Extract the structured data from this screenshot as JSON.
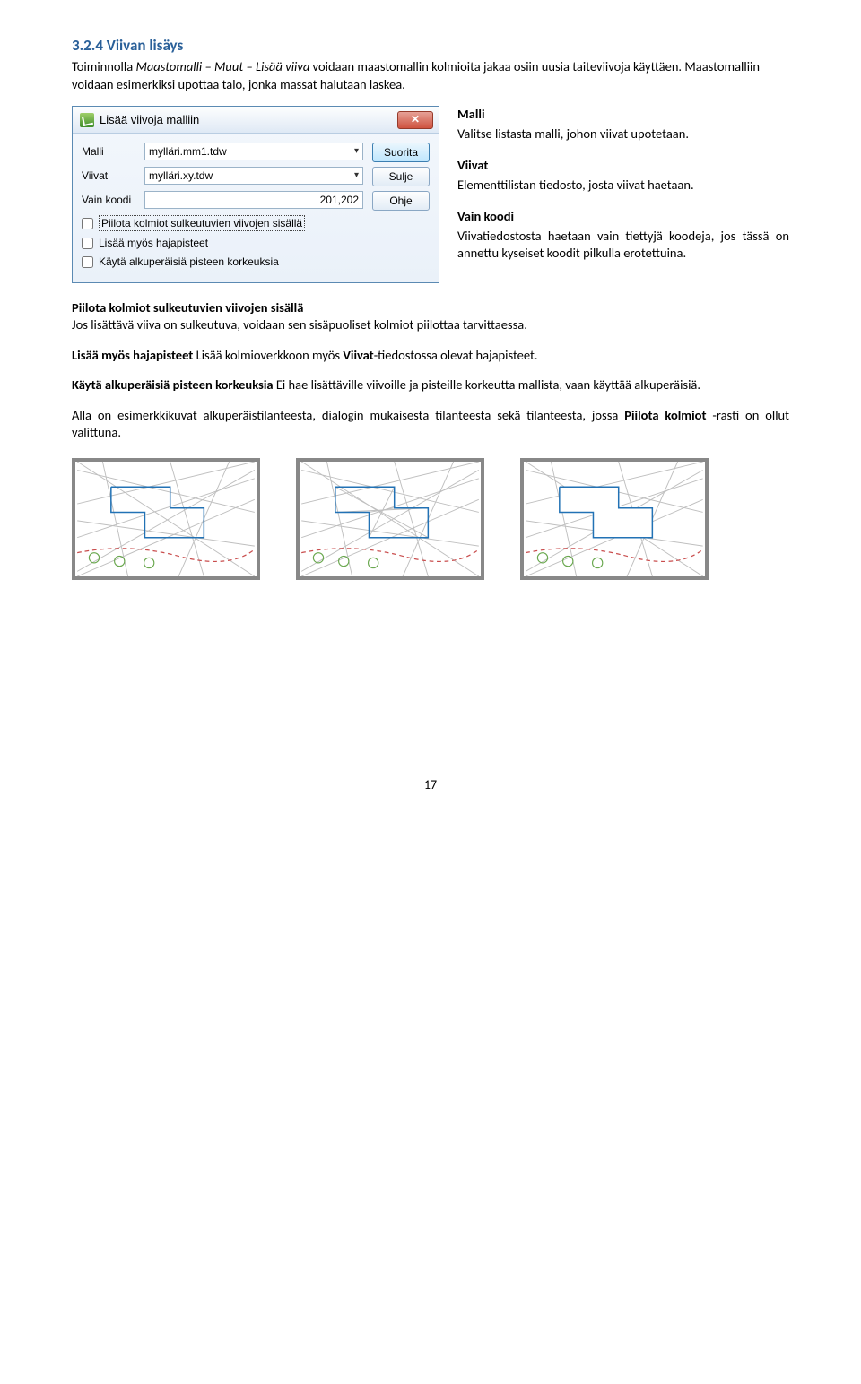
{
  "heading": "3.2.4 Viivan lisäys",
  "intro1_a": "Toiminnolla ",
  "intro1_b": "Maastomalli – Muut – Lisää viiva",
  "intro1_c": " voidaan maastomallin kolmioita jakaa osiin uusia taiteviivoja käyttäen. Maastomalliin voidaan esimerkiksi upottaa talo, jonka massat halutaan laskea.",
  "dialog": {
    "title": "Lisää viivoja malliin",
    "close": "✕",
    "fields": {
      "malli_label": "Malli",
      "malli_value": "mylläri.mm1.tdw",
      "viivat_label": "Viivat",
      "viivat_value": "mylläri.xy.tdw",
      "koodi_label": "Vain koodi",
      "koodi_value": "201,202"
    },
    "buttons": {
      "suorita": "Suorita",
      "sulje": "Sulje",
      "ohje": "Ohje"
    },
    "checks": {
      "c1": "Piilota kolmiot sulkeutuvien viivojen sisällä",
      "c2": "Lisää myös hajapisteet",
      "c3": "Käytä alkuperäisiä pisteen korkeuksia"
    }
  },
  "side": {
    "malli_h": "Malli",
    "malli_t": "Valitse listasta malli, johon viivat upotetaan.",
    "viivat_h": "Viivat",
    "viivat_t": "Elementtilistan tiedosto, josta viivat haetaan.",
    "koodi_h": "Vain koodi",
    "koodi_t": "Viivatiedostosta haetaan vain tiettyjä koodeja, jos tässä on annettu kyseiset koodit pilkulla erotettuina."
  },
  "p1_h": "Piilota kolmiot sulkeutuvien viivojen sisällä",
  "p1_t": "Jos lisättävä viiva on sulkeutuva, voidaan sen sisäpuoliset kolmiot piilottaa tarvittaessa.",
  "p2_a": "Lisää myös hajapisteet",
  "p2_b": " Lisää kolmioverkkoon myös ",
  "p2_c": "Viivat",
  "p2_d": "-tiedostossa olevat hajapisteet.",
  "p3_a": "Käytä alkuperäisiä pisteen korkeuksia",
  "p3_b": " Ei hae lisättäville viivoille ja pisteille korkeutta mallista, vaan käyttää alkuperäisiä.",
  "p4_a": "Alla on esimerkkikuvat alkuperäistilanteesta, dialogin mukaisesta tilanteesta sekä tilanteesta, jossa ",
  "p4_b": "Piilota kolmiot",
  "p4_c": " -rasti on ollut valittuna.",
  "pagenum": "17"
}
